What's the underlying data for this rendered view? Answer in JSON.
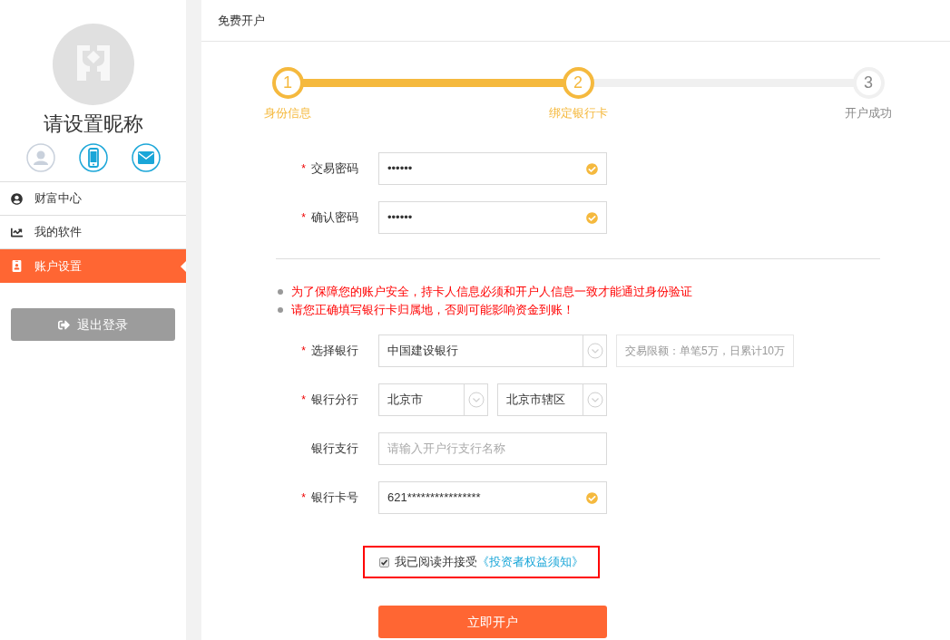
{
  "sidebar": {
    "nickname": "请设置昵称",
    "bindings": [
      {
        "kind": "user",
        "bound": false
      },
      {
        "kind": "phone",
        "bound": true
      },
      {
        "kind": "mail",
        "bound": true
      }
    ],
    "menu": [
      {
        "kind": "wealth",
        "label": "财富中心",
        "selected": false
      },
      {
        "kind": "software",
        "label": "我的软件",
        "selected": false
      },
      {
        "kind": "account",
        "label": "账户设置",
        "selected": true
      }
    ],
    "logout": "退出登录"
  },
  "page": {
    "title": "免费开户",
    "steps": [
      {
        "number": "1",
        "label": "身份信息",
        "reached": true
      },
      {
        "number": "2",
        "label": "绑定银行卡",
        "reached": true
      },
      {
        "number": "3",
        "label": "开户成功",
        "reached": false
      }
    ],
    "password_rows": [
      {
        "kind": "input",
        "label": "交易密码",
        "mark": "*",
        "value": "••••••",
        "valid": true
      },
      {
        "kind": "input",
        "label": "确认密码",
        "mark": "*",
        "value": "••••••",
        "valid": true
      }
    ],
    "notes": [
      "为了保障您的账户安全，持卡人信息必须和开户人信息一致才能通过身份验证",
      "请您正确填写银行卡归属地，否则可能影响资金到账！"
    ],
    "bank_rows": [
      {
        "kind": "select",
        "label": "选择银行",
        "mark": "*",
        "selects": [
          "中国建设银行"
        ],
        "hint": "交易限额：单笔5万，日累计10万"
      },
      {
        "kind": "select",
        "label": "银行分行",
        "mark": "*",
        "selects": [
          "北京市",
          "北京市辖区"
        ]
      },
      {
        "kind": "input",
        "label": "银行支行",
        "placeholder": "请输入开户行支行名称"
      },
      {
        "kind": "input",
        "label": "银行卡号",
        "mark": "*",
        "value": "621****************",
        "valid": true
      }
    ],
    "agreement": {
      "checked": true,
      "text": "我已阅读并接受",
      "link": "《投资者权益须知》"
    },
    "submit": "立即开户"
  }
}
